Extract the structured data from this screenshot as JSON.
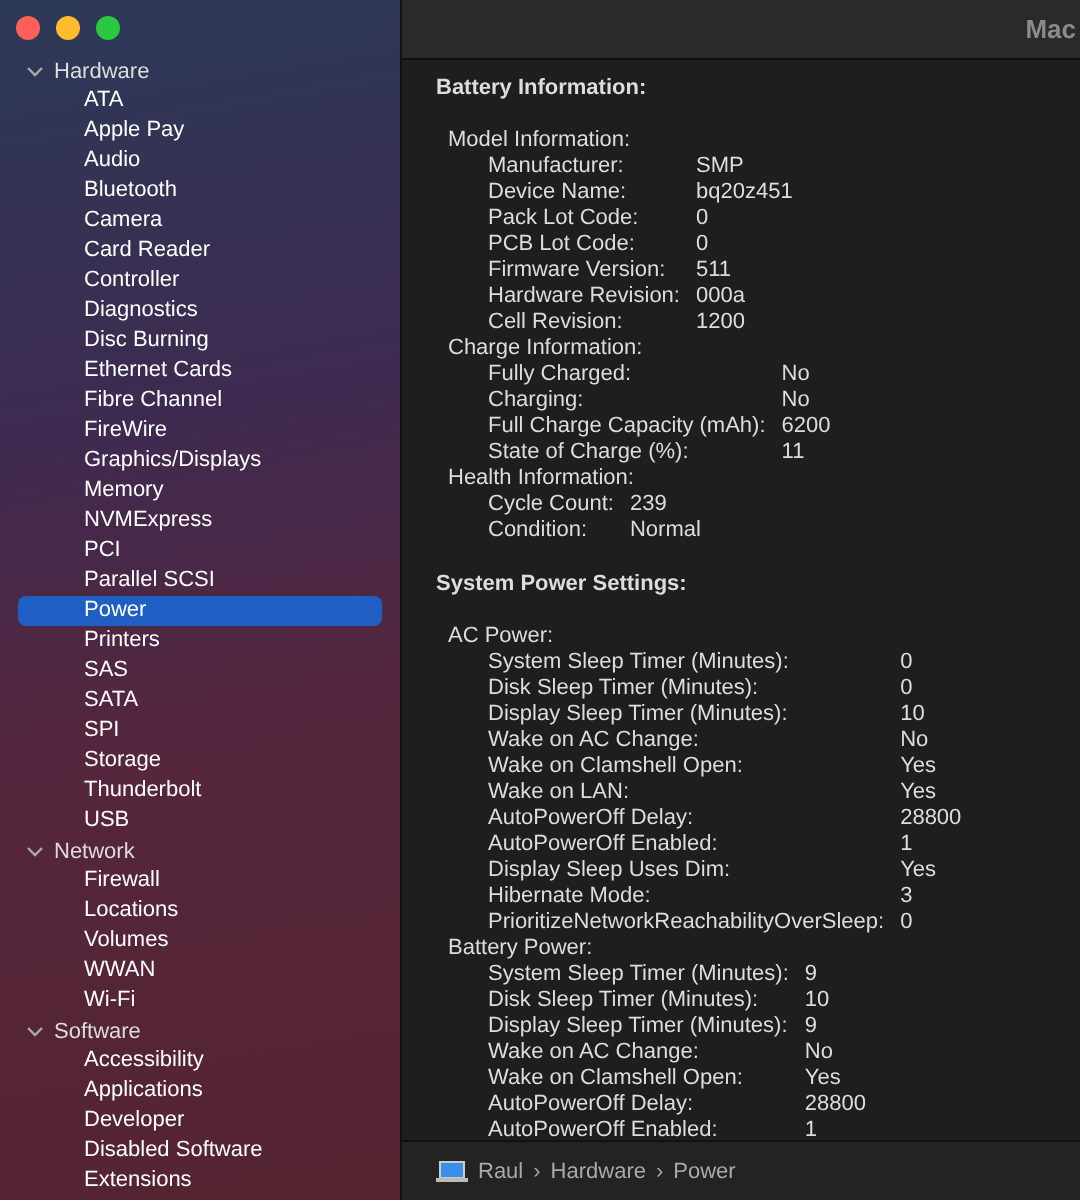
{
  "window": {
    "title": "Mac"
  },
  "sidebar": {
    "groups": [
      {
        "label": "Hardware",
        "expanded": true,
        "items": [
          {
            "label": "ATA",
            "selected": false
          },
          {
            "label": "Apple Pay",
            "selected": false
          },
          {
            "label": "Audio",
            "selected": false
          },
          {
            "label": "Bluetooth",
            "selected": false
          },
          {
            "label": "Camera",
            "selected": false
          },
          {
            "label": "Card Reader",
            "selected": false
          },
          {
            "label": "Controller",
            "selected": false
          },
          {
            "label": "Diagnostics",
            "selected": false
          },
          {
            "label": "Disc Burning",
            "selected": false
          },
          {
            "label": "Ethernet Cards",
            "selected": false
          },
          {
            "label": "Fibre Channel",
            "selected": false
          },
          {
            "label": "FireWire",
            "selected": false
          },
          {
            "label": "Graphics/Displays",
            "selected": false
          },
          {
            "label": "Memory",
            "selected": false
          },
          {
            "label": "NVMExpress",
            "selected": false
          },
          {
            "label": "PCI",
            "selected": false
          },
          {
            "label": "Parallel SCSI",
            "selected": false
          },
          {
            "label": "Power",
            "selected": true
          },
          {
            "label": "Printers",
            "selected": false
          },
          {
            "label": "SAS",
            "selected": false
          },
          {
            "label": "SATA",
            "selected": false
          },
          {
            "label": "SPI",
            "selected": false
          },
          {
            "label": "Storage",
            "selected": false
          },
          {
            "label": "Thunderbolt",
            "selected": false
          },
          {
            "label": "USB",
            "selected": false
          }
        ]
      },
      {
        "label": "Network",
        "expanded": true,
        "items": [
          {
            "label": "Firewall",
            "selected": false
          },
          {
            "label": "Locations",
            "selected": false
          },
          {
            "label": "Volumes",
            "selected": false
          },
          {
            "label": "WWAN",
            "selected": false
          },
          {
            "label": "Wi-Fi",
            "selected": false
          }
        ]
      },
      {
        "label": "Software",
        "expanded": true,
        "items": [
          {
            "label": "Accessibility",
            "selected": false
          },
          {
            "label": "Applications",
            "selected": false
          },
          {
            "label": "Developer",
            "selected": false
          },
          {
            "label": "Disabled Software",
            "selected": false
          },
          {
            "label": "Extensions",
            "selected": false
          }
        ]
      }
    ]
  },
  "sections": [
    {
      "title": "Battery Information:",
      "groups": [
        {
          "label": "Model Information:",
          "rows": [
            [
              "Manufacturer:",
              "SMP"
            ],
            [
              "Device Name:",
              "bq20z451"
            ],
            [
              "Pack Lot Code:",
              "0"
            ],
            [
              "PCB Lot Code:",
              "0"
            ],
            [
              "Firmware Version:",
              "511"
            ],
            [
              "Hardware Revision:",
              "000a"
            ],
            [
              "Cell Revision:",
              "1200"
            ]
          ]
        },
        {
          "label": "Charge Information:",
          "rows": [
            [
              "Fully Charged:",
              "No"
            ],
            [
              "Charging:",
              "No"
            ],
            [
              "Full Charge Capacity (mAh):",
              "6200"
            ],
            [
              "State of Charge (%):",
              "11"
            ]
          ]
        },
        {
          "label": "Health Information:",
          "rows": [
            [
              "Cycle Count:",
              "239"
            ],
            [
              "Condition:",
              "Normal"
            ]
          ]
        }
      ]
    },
    {
      "title": "System Power Settings:",
      "groups": [
        {
          "label": "AC Power:",
          "rows": [
            [
              "System Sleep Timer (Minutes):",
              "0"
            ],
            [
              "Disk Sleep Timer (Minutes):",
              "0"
            ],
            [
              "Display Sleep Timer (Minutes):",
              "10"
            ],
            [
              "Wake on AC Change:",
              "No"
            ],
            [
              "Wake on Clamshell Open:",
              "Yes"
            ],
            [
              "Wake on LAN:",
              "Yes"
            ],
            [
              "AutoPowerOff Delay:",
              "28800"
            ],
            [
              "AutoPowerOff Enabled:",
              "1"
            ],
            [
              "Display Sleep Uses Dim:",
              "Yes"
            ],
            [
              "Hibernate Mode:",
              "3"
            ],
            [
              "PrioritizeNetworkReachabilityOverSleep:",
              "0"
            ]
          ]
        },
        {
          "label": "Battery Power:",
          "rows": [
            [
              "System Sleep Timer (Minutes):",
              "9"
            ],
            [
              "Disk Sleep Timer (Minutes):",
              "10"
            ],
            [
              "Display Sleep Timer (Minutes):",
              "9"
            ],
            [
              "Wake on AC Change:",
              "No"
            ],
            [
              "Wake on Clamshell Open:",
              "Yes"
            ],
            [
              "AutoPowerOff Delay:",
              "28800"
            ],
            [
              "AutoPowerOff Enabled:",
              "1"
            ]
          ]
        }
      ]
    }
  ],
  "path_bar": [
    "Raul",
    "Hardware",
    "Power"
  ],
  "path_separator": "›"
}
